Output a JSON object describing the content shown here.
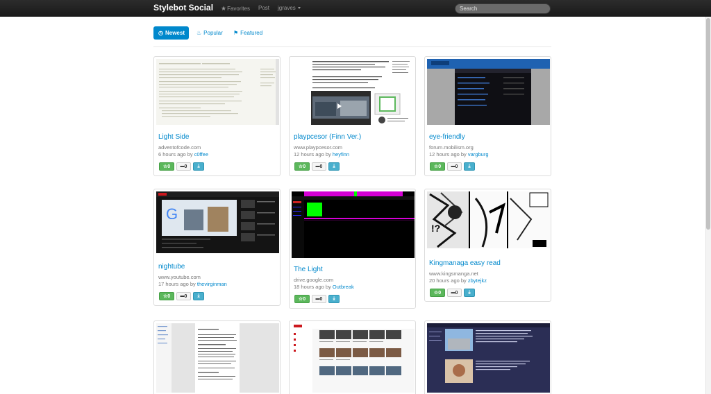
{
  "app": {
    "brand": "Stylebot Social"
  },
  "nav": {
    "favorites": "Favorites",
    "post": "Post",
    "user": "jgraves",
    "search_placeholder": "Search"
  },
  "tabs": [
    {
      "label": "Newest",
      "icon": "clock-icon",
      "active": true
    },
    {
      "label": "Popular",
      "icon": "fire-icon",
      "active": false
    },
    {
      "label": "Featured",
      "icon": "tag-icon",
      "active": false
    }
  ],
  "colors": {
    "accent": "#0088cc",
    "navbar": "#222222",
    "favorite_button": "#5bb75b",
    "download_button": "#49afcd"
  },
  "styles": [
    {
      "title": "Light Side",
      "site": "adventofcode.com",
      "time": "6 hours ago by",
      "author": "c0ffee",
      "favorites": "0",
      "comments": "0"
    },
    {
      "title": "playpcesor (Finn Ver.)",
      "site": "www.playpcesor.com",
      "time": "12 hours ago by",
      "author": "heyfinn",
      "favorites": "0",
      "comments": "0"
    },
    {
      "title": "eye-friendly",
      "site": "forum.mobilism.org",
      "time": "12 hours ago by",
      "author": "vargburg",
      "favorites": "0",
      "comments": "0"
    },
    {
      "title": "nightube",
      "site": "www.youtube.com",
      "time": "17 hours ago by",
      "author": "thevirginman",
      "favorites": "0",
      "comments": "0"
    },
    {
      "title": "The Light",
      "site": "drive.google.com",
      "time": "18 hours ago by",
      "author": "Outbreak",
      "favorites": "0",
      "comments": "0"
    },
    {
      "title": "Kingmanaga easy read",
      "site": "www.kingsmanga.net",
      "time": "20 hours ago by",
      "author": "zbytejkz",
      "favorites": "0",
      "comments": "0"
    }
  ]
}
